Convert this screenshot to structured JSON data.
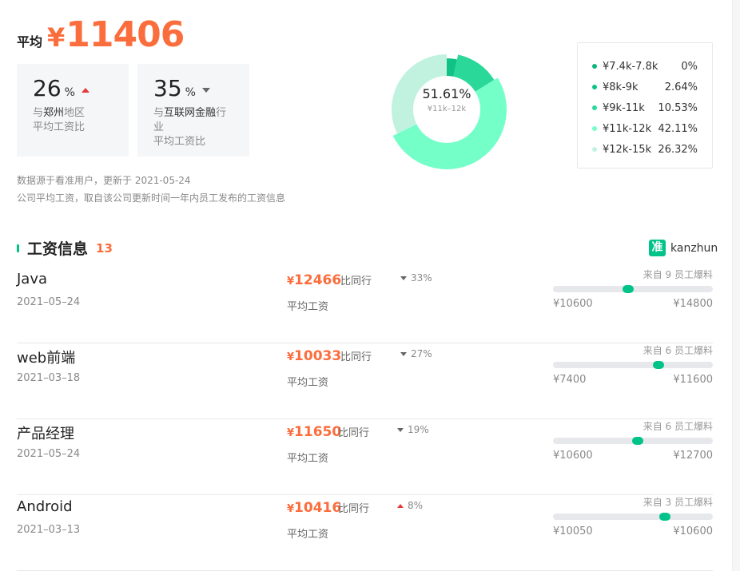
{
  "summary": {
    "avg_label": "平均",
    "currency": "¥",
    "avg_value": "11406"
  },
  "comparisons": [
    {
      "value": "26",
      "unit": "%",
      "trend": "up",
      "prefix": "与",
      "highlight": "郑州",
      "suffix": "地区",
      "line2": "平均工资比"
    },
    {
      "value": "35",
      "unit": "%",
      "trend": "down",
      "prefix": "与",
      "highlight": "互联网金融",
      "suffix": "行业",
      "line2": "平均工资比"
    }
  ],
  "notes": [
    "数据源于看准用户，更新于 2021-05-24",
    "公司平均工资，取自该公司更新时间一年内员工发布的工资信息"
  ],
  "donut": {
    "center_value": "51.61%",
    "center_label": "¥11k–12k"
  },
  "chart_data": {
    "type": "pie",
    "series": [
      {
        "label": "¥7.4k-7.8k",
        "value": 0,
        "display": "0%",
        "color": "#0fb47e"
      },
      {
        "label": "¥8k-9k",
        "value": 2.64,
        "display": "2.64%",
        "color": "#10c285"
      },
      {
        "label": "¥9k-11k",
        "value": 10.53,
        "display": "10.53%",
        "color": "#2ad89a"
      },
      {
        "label": "¥11k-12k",
        "value": 42.11,
        "display": "42.11%",
        "color": "#74ffc9"
      },
      {
        "label": "¥12k-15k",
        "value": 26.32,
        "display": "26.32%",
        "color": "#c1f2e0"
      }
    ]
  },
  "section": {
    "title": "工资信息",
    "count": "13",
    "brand_logo": "准",
    "brand_name": "kanzhun"
  },
  "salary_rows": [
    {
      "title": "Java",
      "date": "2021–05–24",
      "salary": "12466",
      "avg_label": "平均工资",
      "peer_label": "比同行",
      "trend": "down",
      "peer_value": "33%",
      "source": "来自 9 员工爆料",
      "min": "¥10600",
      "max": "¥14800",
      "position": 0.47
    },
    {
      "title": "web前端",
      "date": "2021–03–18",
      "salary": "10033",
      "avg_label": "平均工资",
      "peer_label": "比同行",
      "trend": "down",
      "peer_value": "27%",
      "source": "来自 6 员工爆料",
      "min": "¥7400",
      "max": "¥11600",
      "position": 0.66
    },
    {
      "title": "产品经理",
      "date": "2021–05–24",
      "salary": "11650",
      "avg_label": "平均工资",
      "peer_label": "比同行",
      "trend": "down",
      "peer_value": "19%",
      "source": "来自 6 员工爆料",
      "min": "¥10600",
      "max": "¥12700",
      "position": 0.53
    },
    {
      "title": "Android",
      "date": "2021–03–13",
      "salary": "10416",
      "avg_label": "平均工资",
      "peer_label": "比同行",
      "trend": "up",
      "peer_value": "8%",
      "source": "来自 3 员工爆料",
      "min": "¥10050",
      "max": "¥10600",
      "position": 0.7
    }
  ]
}
